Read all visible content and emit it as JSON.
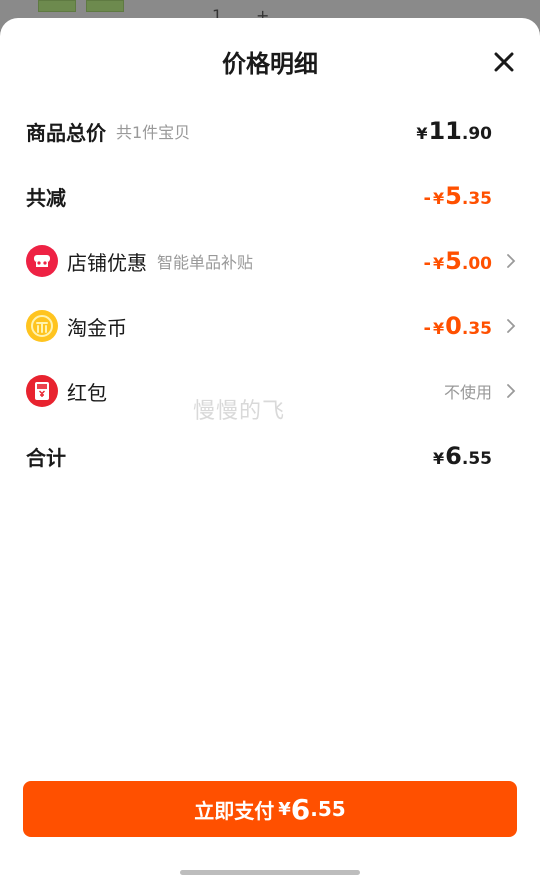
{
  "backdrop": {
    "stepper_value": "1",
    "stepper_plus": "+"
  },
  "sheet": {
    "title": "价格明细"
  },
  "rows": {
    "total": {
      "label": "商品总价",
      "sub": "共1件宝贝",
      "yen": "¥",
      "int": "11",
      "dec": ".90"
    },
    "discount": {
      "label": "共减",
      "minus": "-",
      "yen": "¥",
      "int": "5",
      "dec": ".35"
    },
    "shop": {
      "label": "店铺优惠",
      "sub": "智能单品补贴",
      "minus": "-",
      "yen": "¥",
      "int": "5",
      "dec": ".00"
    },
    "coin": {
      "label": "淘金币",
      "minus": "-",
      "yen": "¥",
      "int": "0",
      "dec": ".35"
    },
    "redpacket": {
      "label": "红包",
      "value": "不使用"
    },
    "sum": {
      "label": "合计",
      "yen": "¥",
      "int": "6",
      "dec": ".55"
    }
  },
  "watermark": "慢慢的飞",
  "pay_button": {
    "label": "立即支付",
    "yen": "¥",
    "int": "6",
    "dec": ".55"
  },
  "colors": {
    "accent": "#ff5000",
    "shop_icon": "#ee2244",
    "coin_icon": "#ffc41f",
    "redpacket_icon": "#e8232f"
  }
}
